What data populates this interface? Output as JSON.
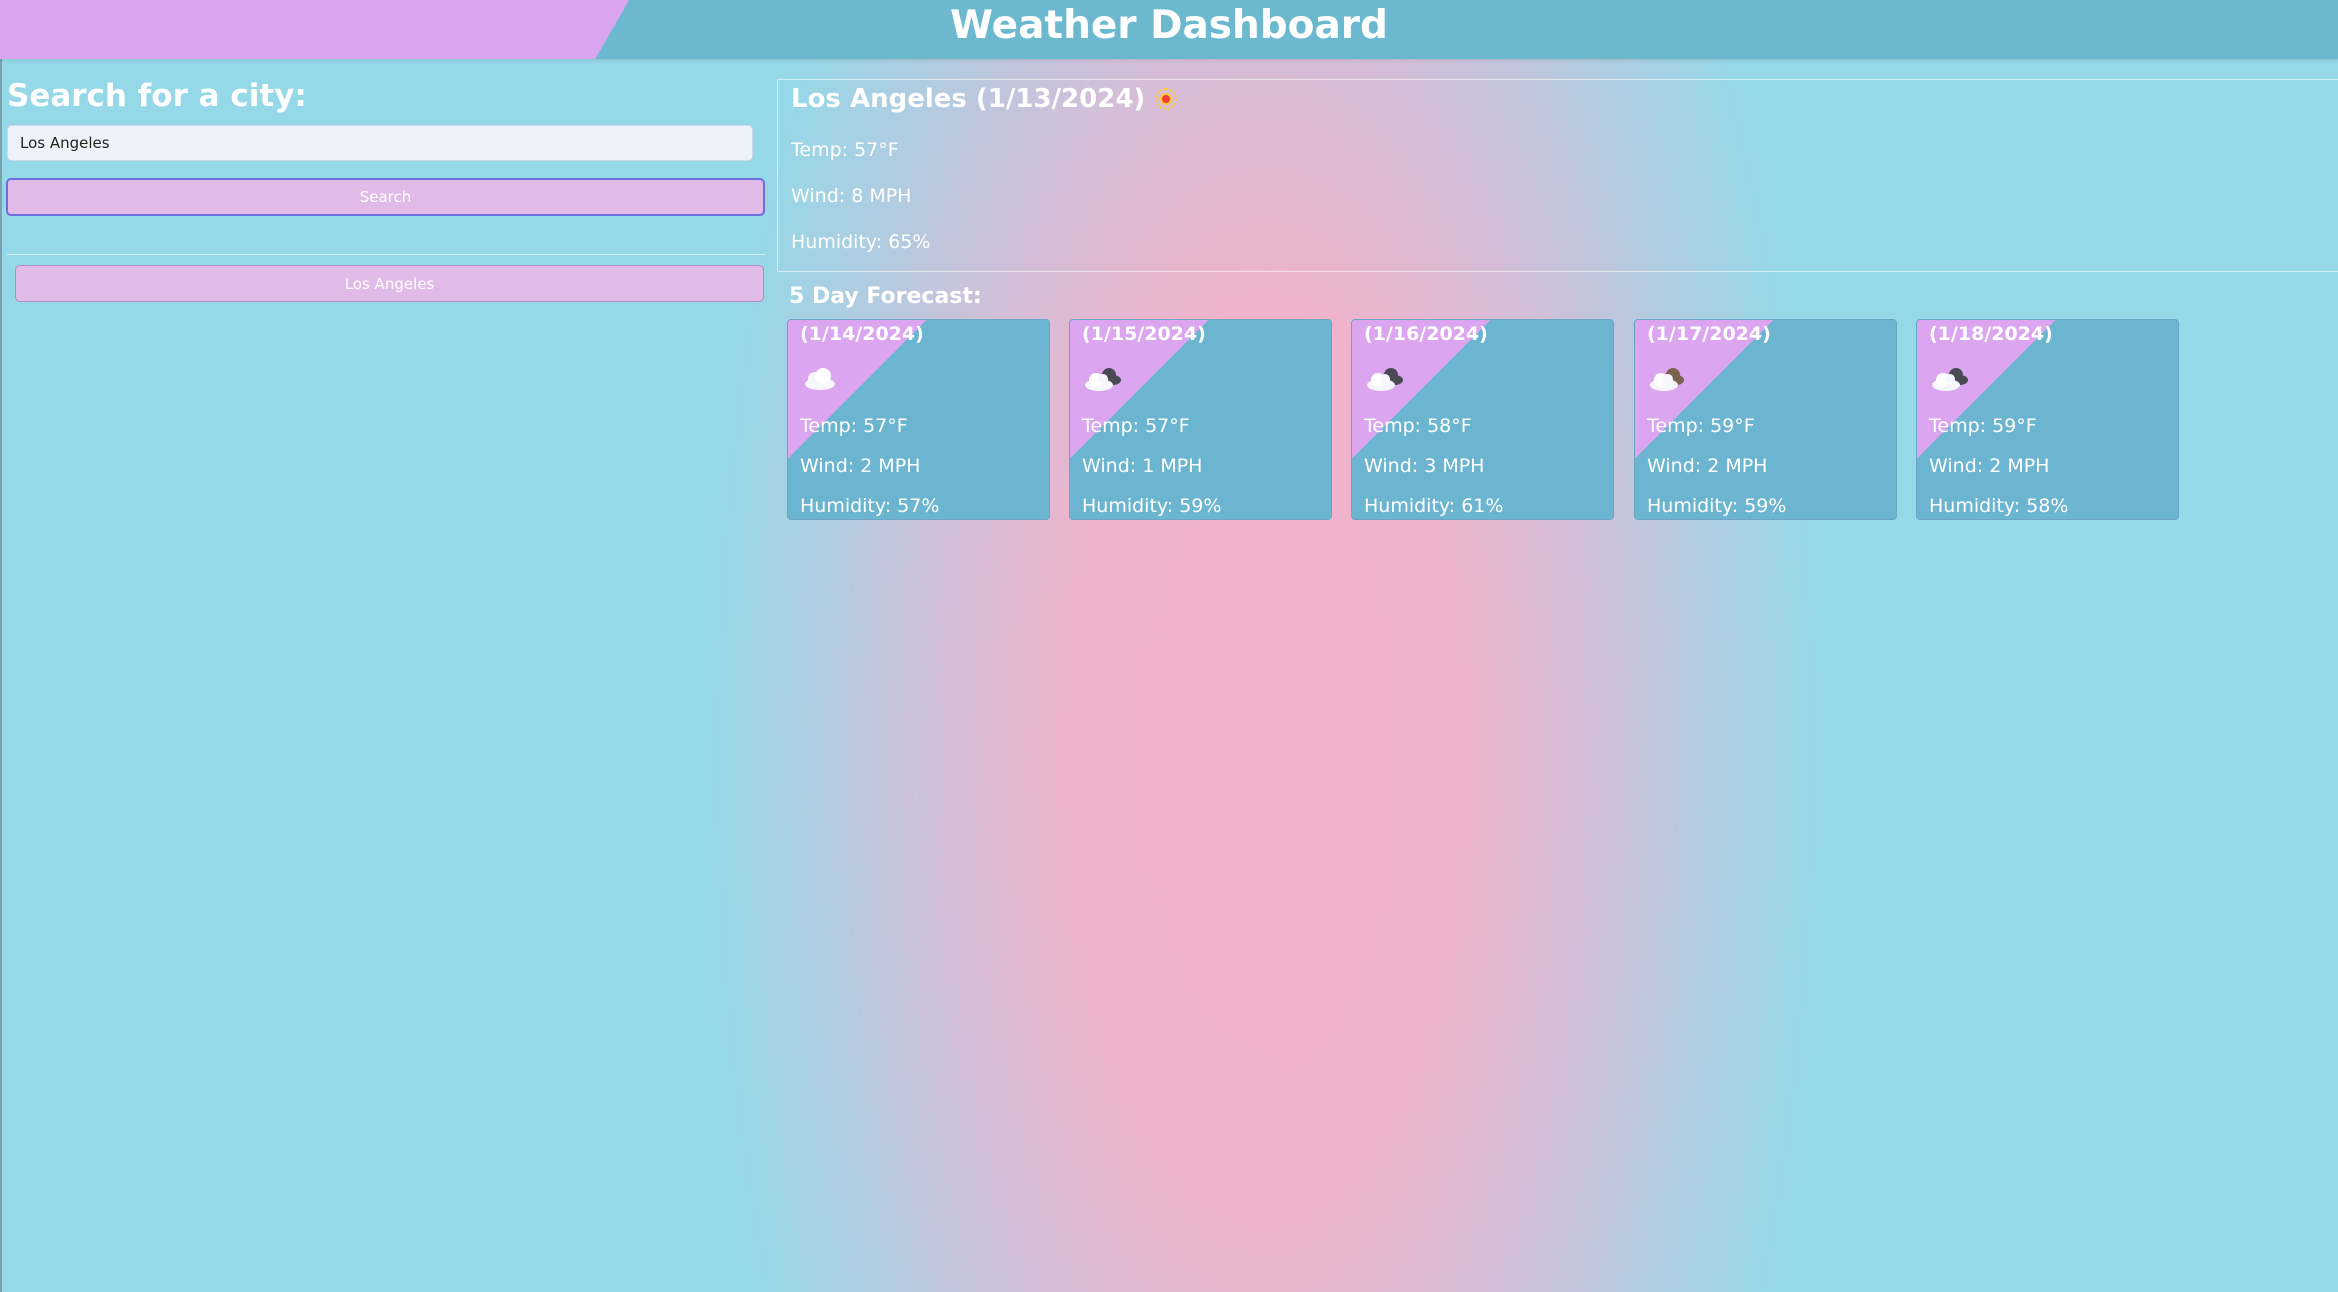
{
  "header": {
    "title": "Weather Dashboard"
  },
  "sidebar": {
    "heading": "Search for a city:",
    "search_value": "Los Angeles",
    "search_button": "Search",
    "history": [
      "Los Angeles"
    ]
  },
  "current": {
    "title": "Los Angeles (1/13/2024)",
    "icon": "sun-icon",
    "temp": "Temp: 57°F",
    "wind": "Wind: 8 MPH",
    "humidity": "Humidity: 65%"
  },
  "forecast": {
    "heading": "5 Day Forecast:",
    "days": [
      {
        "date": "(1/14/2024)",
        "icon": "cloud-icon",
        "temp": "Temp: 57°F",
        "wind": "Wind: 2 MPH",
        "humidity": "Humidity: 57%"
      },
      {
        "date": "(1/15/2024)",
        "icon": "dark-clouds-icon",
        "temp": "Temp: 57°F",
        "wind": "Wind: 1 MPH",
        "humidity": "Humidity: 59%"
      },
      {
        "date": "(1/16/2024)",
        "icon": "dark-clouds-icon",
        "temp": "Temp: 58°F",
        "wind": "Wind: 3 MPH",
        "humidity": "Humidity: 61%"
      },
      {
        "date": "(1/17/2024)",
        "icon": "brown-clouds-icon",
        "temp": "Temp: 59°F",
        "wind": "Wind: 2 MPH",
        "humidity": "Humidity: 59%"
      },
      {
        "date": "(1/18/2024)",
        "icon": "dark-clouds-icon",
        "temp": "Temp: 59°F",
        "wind": "Wind: 2 MPH",
        "humidity": "Humidity: 58%"
      }
    ]
  },
  "colors": {
    "header_pink": "#dba6ef",
    "header_teal": "#6cb9cf",
    "button_pink": "#e1bbe7",
    "card_teal": "#6cb5d0",
    "background_blue": "#95d8e8",
    "background_pink": "#f1b2cb"
  }
}
